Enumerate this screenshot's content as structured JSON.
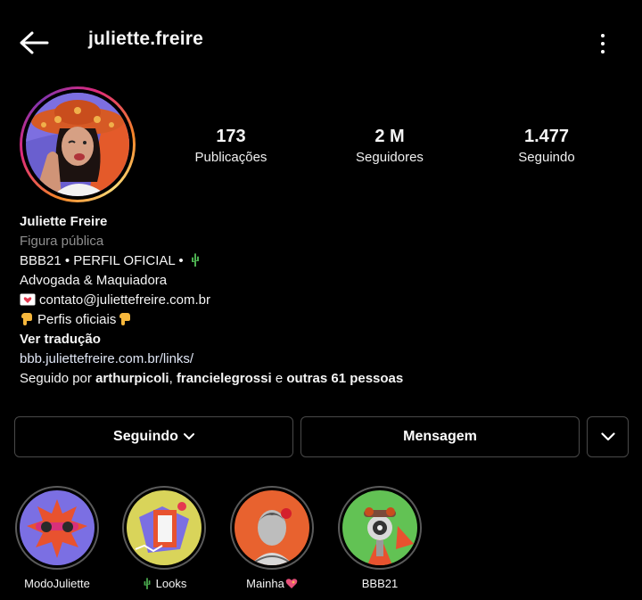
{
  "header": {
    "username": "juliette.freire"
  },
  "stats": [
    {
      "value": "173",
      "label": "Publicações"
    },
    {
      "value": "2 M",
      "label": "Seguidores"
    },
    {
      "value": "1.477",
      "label": "Seguindo"
    }
  ],
  "bio": {
    "name": "Juliette Freire",
    "category": "Figura pública",
    "line1": "BBB21 • PERFIL OFICIAL •",
    "line2": "Advogada & Maquiadora",
    "line3": "contato@juliettefreire.com.br",
    "line4": "Perfis oficiais",
    "translate": "Ver tradução",
    "link": "bbb.juliettefreire.com.br/links/",
    "followed_prefix": "Seguido por",
    "followed_user1": "arthurpicoli",
    "followed_comma": ",",
    "followed_user2": "francielegrossi",
    "followed_and": "e",
    "followed_others": "outras 61 pessoas"
  },
  "actions": {
    "following": "Seguindo",
    "message": "Mensagem"
  },
  "highlights": [
    {
      "label": "ModoJuliette"
    },
    {
      "label": "Looks",
      "prefix_icon": "cactus-icon"
    },
    {
      "label": "Mainha",
      "suffix_icon": "heart-sparkle-icon"
    },
    {
      "label": "BBB21"
    }
  ],
  "icons": [
    "back-arrow-icon",
    "more-options-icon",
    "cactus-icon",
    "envelope-heart-icon",
    "pointing-down-icon",
    "chevron-down-icon"
  ],
  "colors": {
    "background": "#000000",
    "text": "#f5f5f5",
    "muted": "#8e8e8e",
    "border": "#4a4a4a"
  }
}
